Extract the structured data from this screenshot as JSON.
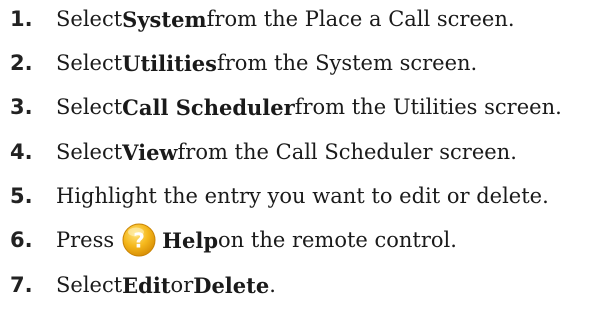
{
  "steps": [
    {
      "number": "1.",
      "parts": [
        "Select ",
        "System",
        " from the Place a Call screen."
      ]
    },
    {
      "number": "2.",
      "parts": [
        "Select ",
        "Utilities",
        " from the System screen."
      ]
    },
    {
      "number": "3.",
      "parts": [
        "Select ",
        "Call Scheduler",
        " from the Utilities screen."
      ]
    },
    {
      "number": "4.",
      "parts": [
        "Select ",
        "View",
        " from the Call Scheduler screen."
      ]
    },
    {
      "number": "5.",
      "parts": [
        "Highlight the entry you want to edit or delete."
      ]
    },
    {
      "number": "6.",
      "parts": [
        "Press ",
        "Help",
        " on the remote control."
      ],
      "icon": "help-question-icon",
      "icon_color": "#f2b21a"
    },
    {
      "number": "7.",
      "parts": [
        "Select ",
        "Edit",
        " or ",
        "Delete",
        "."
      ]
    }
  ]
}
